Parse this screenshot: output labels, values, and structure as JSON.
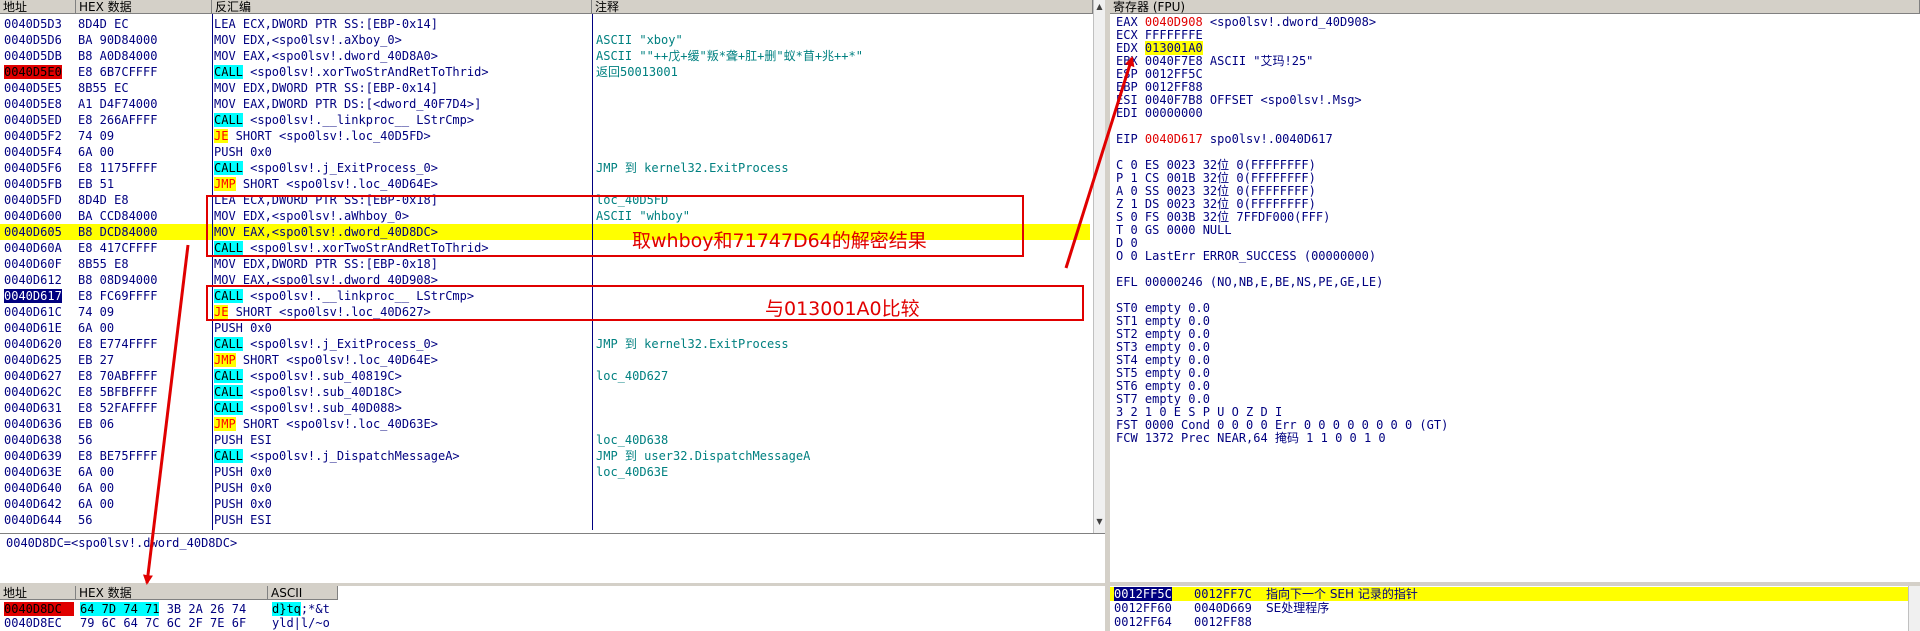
{
  "disasm": {
    "headers": {
      "addr": "地址",
      "hex": "HEX 数据",
      "dis": "反汇编",
      "comment": "注释"
    },
    "rows": [
      {
        "addr": "0040D5D3",
        "hex": "8D4D EC",
        "pre": "LEA ECX,DWORD PTR SS:[EBP-0x14]",
        "kw": "",
        "post": "",
        "comment": ""
      },
      {
        "addr": "0040D5D6",
        "hex": "BA 90D84000",
        "pre": "MOV EDX,<spo0lsv!.aXboy_0>",
        "kw": "",
        "post": "",
        "comment": "ASCII \"xboy\""
      },
      {
        "addr": "0040D5DB",
        "hex": "B8 A0D84000",
        "pre": "MOV EAX,<spo0lsv!.dword_40D8A0>",
        "kw": "",
        "post": "",
        "comment": "ASCII \"\"++戊+缓\"叛*聋+肛+删\"蚁*苜+兆++*\""
      },
      {
        "addr": "0040D5E0",
        "hex": "E8 6B7CFFFF",
        "pre": "",
        "kw": "CALL",
        "post": " <spo0lsv!.xorTwoStrAndRetToThrid>",
        "comment": "返回50013001",
        "addrStyle": "red",
        "kwStyle": "call"
      },
      {
        "addr": "0040D5E5",
        "hex": "8B55 EC",
        "pre": "MOV EDX,DWORD PTR SS:[EBP-0x14]",
        "kw": "",
        "post": "",
        "comment": ""
      },
      {
        "addr": "0040D5E8",
        "hex": "A1 D4F74000",
        "pre": "MOV EAX,DWORD PTR DS:[<dword_40F7D4>]",
        "kw": "",
        "post": "",
        "comment": ""
      },
      {
        "addr": "0040D5ED",
        "hex": "E8 266AFFFF",
        "pre": "",
        "kw": "CALL",
        "post": " <spo0lsv!.__linkproc__ LStrCmp>",
        "comment": "",
        "kwStyle": "call"
      },
      {
        "addr": "0040D5F2",
        "hex": "74 09",
        "pre": "",
        "kw": "JE",
        "post": " SHORT <spo0lsv!.loc_40D5FD>",
        "comment": "",
        "kwStyle": "jmp"
      },
      {
        "addr": "0040D5F4",
        "hex": "6A 00",
        "pre": "PUSH 0x0",
        "kw": "",
        "post": "",
        "comment": ""
      },
      {
        "addr": "0040D5F6",
        "hex": "E8 1175FFFF",
        "pre": "",
        "kw": "CALL",
        "post": " <spo0lsv!.j_ExitProcess_0>",
        "comment": "JMP 到 kernel32.ExitProcess",
        "kwStyle": "call"
      },
      {
        "addr": "0040D5FB",
        "hex": "EB 51",
        "pre": "",
        "kw": "JMP",
        "post": " SHORT <spo0lsv!.loc_40D64E>",
        "comment": "",
        "kwStyle": "jmp"
      },
      {
        "addr": "0040D5FD",
        "hex": "8D4D E8",
        "pre": "LEA ECX,DWORD PTR SS:[EBP-0x18]",
        "kw": "",
        "post": "",
        "comment": "loc_40D5FD"
      },
      {
        "addr": "0040D600",
        "hex": "BA CCD84000",
        "pre": "MOV EDX,<spo0lsv!.aWhboy_0>",
        "kw": "",
        "post": "",
        "comment": "ASCII \"whboy\""
      },
      {
        "addr": "0040D605",
        "hex": "B8 DCD84000",
        "pre": "MOV EAX,<spo0lsv!.dword_40D8DC>",
        "kw": "",
        "post": "",
        "comment": "",
        "selected": true
      },
      {
        "addr": "0040D60A",
        "hex": "E8 417CFFFF",
        "pre": "",
        "kw": "CALL",
        "post": " <spo0lsv!.xorTwoStrAndRetToThrid>",
        "comment": "",
        "kwStyle": "call"
      },
      {
        "addr": "0040D60F",
        "hex": "8B55 E8",
        "pre": "MOV EDX,DWORD PTR SS:[EBP-0x18]",
        "kw": "",
        "post": "",
        "comment": ""
      },
      {
        "addr": "0040D612",
        "hex": "B8 08D94000",
        "pre": "MOV EAX,<spo0lsv!.dword_40D908>",
        "kw": "",
        "post": "",
        "comment": ""
      },
      {
        "addr": "0040D617",
        "hex": "E8 FC69FFFF",
        "pre": "",
        "kw": "CALL",
        "post": " <spo0lsv!.__linkproc__ LStrCmp>",
        "comment": "",
        "addrStyle": "blue",
        "kwStyle": "call"
      },
      {
        "addr": "0040D61C",
        "hex": "74 09",
        "pre": "",
        "kw": "JE",
        "post": " SHORT <spo0lsv!.loc_40D627>",
        "comment": "",
        "kwStyle": "jmp"
      },
      {
        "addr": "0040D61E",
        "hex": "6A 00",
        "pre": "PUSH 0x0",
        "kw": "",
        "post": "",
        "comment": ""
      },
      {
        "addr": "0040D620",
        "hex": "E8 E774FFFF",
        "pre": "",
        "kw": "CALL",
        "post": " <spo0lsv!.j_ExitProcess_0>",
        "comment": "JMP 到 kernel32.ExitProcess",
        "kwStyle": "call"
      },
      {
        "addr": "0040D625",
        "hex": "EB 27",
        "pre": "",
        "kw": "JMP",
        "post": " SHORT <spo0lsv!.loc_40D64E>",
        "comment": "",
        "kwStyle": "jmp"
      },
      {
        "addr": "0040D627",
        "hex": "E8 70ABFFFF",
        "pre": "",
        "kw": "CALL",
        "post": " <spo0lsv!.sub_40819C>",
        "comment": "loc_40D627",
        "kwStyle": "call"
      },
      {
        "addr": "0040D62C",
        "hex": "E8 5BFBFFFF",
        "pre": "",
        "kw": "CALL",
        "post": " <spo0lsv!.sub_40D18C>",
        "comment": "",
        "kwStyle": "call"
      },
      {
        "addr": "0040D631",
        "hex": "E8 52FAFFFF",
        "pre": "",
        "kw": "CALL",
        "post": " <spo0lsv!.sub_40D088>",
        "comment": "",
        "kwStyle": "call"
      },
      {
        "addr": "0040D636",
        "hex": "EB 06",
        "pre": "",
        "kw": "JMP",
        "post": " SHORT <spo0lsv!.loc_40D63E>",
        "comment": "",
        "kwStyle": "jmp"
      },
      {
        "addr": "0040D638",
        "hex": "56",
        "pre": "PUSH ESI",
        "kw": "",
        "post": "",
        "comment": "loc_40D638"
      },
      {
        "addr": "0040D639",
        "hex": "E8 BE75FFFF",
        "pre": "",
        "kw": "CALL",
        "post": " <spo0lsv!.j_DispatchMessageA>",
        "comment": "JMP 到 user32.DispatchMessageA",
        "kwStyle": "call"
      },
      {
        "addr": "0040D63E",
        "hex": "6A 00",
        "pre": "PUSH 0x0",
        "kw": "",
        "post": "",
        "comment": "loc_40D63E"
      },
      {
        "addr": "0040D640",
        "hex": "6A 00",
        "pre": "PUSH 0x0",
        "kw": "",
        "post": "",
        "comment": ""
      },
      {
        "addr": "0040D642",
        "hex": "6A 00",
        "pre": "PUSH 0x0",
        "kw": "",
        "post": "",
        "comment": ""
      },
      {
        "addr": "0040D644",
        "hex": "56",
        "pre": "PUSH ESI",
        "kw": "",
        "post": "",
        "comment": ""
      }
    ],
    "info_line": "0040D8DC=<spo0lsv!.dword_40D8DC>"
  },
  "annotations": {
    "box1_text": "取whboy和71747D64的解密结果",
    "box2_text": "与013001A0比较"
  },
  "registers": {
    "header": "寄存器 (FPU)",
    "lines": [
      {
        "parts": [
          {
            "t": "EAX "
          },
          {
            "t": "0040D908",
            "s": "red"
          },
          {
            "t": " <spo0lsv!.dword_40D908>"
          }
        ]
      },
      {
        "parts": [
          {
            "t": "ECX FFFFFFFE"
          }
        ]
      },
      {
        "parts": [
          {
            "t": "EDX "
          },
          {
            "t": "013001A0",
            "s": "yel"
          }
        ]
      },
      {
        "parts": [
          {
            "t": "EBX 0040F7E8 ASCII \"艾玛!25\""
          }
        ]
      },
      {
        "parts": [
          {
            "t": "ESP 0012FF5C"
          }
        ]
      },
      {
        "parts": [
          {
            "t": "EBP 0012FF88"
          }
        ]
      },
      {
        "parts": [
          {
            "t": "ESI 0040F7B8 OFFSET <spo0lsv!.Msg>"
          }
        ]
      },
      {
        "parts": [
          {
            "t": "EDI 00000000"
          }
        ]
      },
      {
        "parts": [
          {
            "t": ""
          }
        ]
      },
      {
        "parts": [
          {
            "t": "EIP "
          },
          {
            "t": "0040D617",
            "s": "red"
          },
          {
            "t": " spo0lsv!.0040D617"
          }
        ]
      },
      {
        "parts": [
          {
            "t": ""
          }
        ]
      },
      {
        "parts": [
          {
            "t": "C 0  ES 0023 32位 0(FFFFFFFF)"
          }
        ]
      },
      {
        "parts": [
          {
            "t": "P 1  CS 001B 32位 0(FFFFFFFF)"
          }
        ]
      },
      {
        "parts": [
          {
            "t": "A 0  SS 0023 32位 0(FFFFFFFF)"
          }
        ]
      },
      {
        "parts": [
          {
            "t": "Z 1  DS 0023 32位 0(FFFFFFFF)"
          }
        ]
      },
      {
        "parts": [
          {
            "t": "S 0  FS 003B 32位 7FFDF000(FFF)"
          }
        ]
      },
      {
        "parts": [
          {
            "t": "T 0  GS 0000 NULL"
          }
        ]
      },
      {
        "parts": [
          {
            "t": "D 0"
          }
        ]
      },
      {
        "parts": [
          {
            "t": "O 0  LastErr ERROR_SUCCESS (00000000)"
          }
        ]
      },
      {
        "parts": [
          {
            "t": ""
          }
        ]
      },
      {
        "parts": [
          {
            "t": "EFL 00000246 (NO,NB,E,BE,NS,PE,GE,LE)"
          }
        ]
      },
      {
        "parts": [
          {
            "t": ""
          }
        ]
      },
      {
        "parts": [
          {
            "t": "ST0 empty 0.0"
          }
        ]
      },
      {
        "parts": [
          {
            "t": "ST1 empty 0.0"
          }
        ]
      },
      {
        "parts": [
          {
            "t": "ST2 empty 0.0"
          }
        ]
      },
      {
        "parts": [
          {
            "t": "ST3 empty 0.0"
          }
        ]
      },
      {
        "parts": [
          {
            "t": "ST4 empty 0.0"
          }
        ]
      },
      {
        "parts": [
          {
            "t": "ST5 empty 0.0"
          }
        ]
      },
      {
        "parts": [
          {
            "t": "ST6 empty 0.0"
          }
        ]
      },
      {
        "parts": [
          {
            "t": "ST7 empty 0.0"
          }
        ]
      },
      {
        "parts": [
          {
            "t": "               3 2 1 0      E S P U O Z D I"
          }
        ]
      },
      {
        "parts": [
          {
            "t": "FST 0000  Cond 0 0 0 0  Err 0 0 0 0 0 0 0 0  (GT)"
          }
        ]
      },
      {
        "parts": [
          {
            "t": "FCW 1372  Prec NEAR,64  掩码    1 1 0 0 1 0"
          }
        ]
      }
    ]
  },
  "dump": {
    "headers": {
      "addr": "地址",
      "hex": "HEX 数据",
      "ascii": "ASCII"
    },
    "rows": [
      {
        "addr": "0040D8DC",
        "hex1": "64 7D 74 71",
        "hex2": " 3B 2A 26 74",
        "ascii1": "d}tq",
        "ascii2": ";*&t",
        "addrStyle": "red"
      },
      {
        "addr": "0040D8EC",
        "hex1": "79 6C 64 7C",
        "hex2": " 6C 2F 7E 6F",
        "ascii1": "yld|",
        "ascii2": "l/~o",
        "addrStyle": ""
      }
    ]
  },
  "stack": {
    "rows": [
      {
        "addr": "0012FF5C",
        "val": "0012FF7C",
        "desc": "指向下一个 SEH 记录的指针",
        "selected": true
      },
      {
        "addr": "0012FF60",
        "val": "0040D669",
        "desc": "SE处理程序",
        "selected": false
      },
      {
        "addr": "0012FF64",
        "val": "0012FF88",
        "desc": "",
        "selected": false
      }
    ]
  },
  "colors": {
    "accent_red": "#e00000",
    "selection": "#ffff00",
    "call_bg": "#00ffff",
    "text_navy": "#000080",
    "comment_teal": "#008080"
  }
}
